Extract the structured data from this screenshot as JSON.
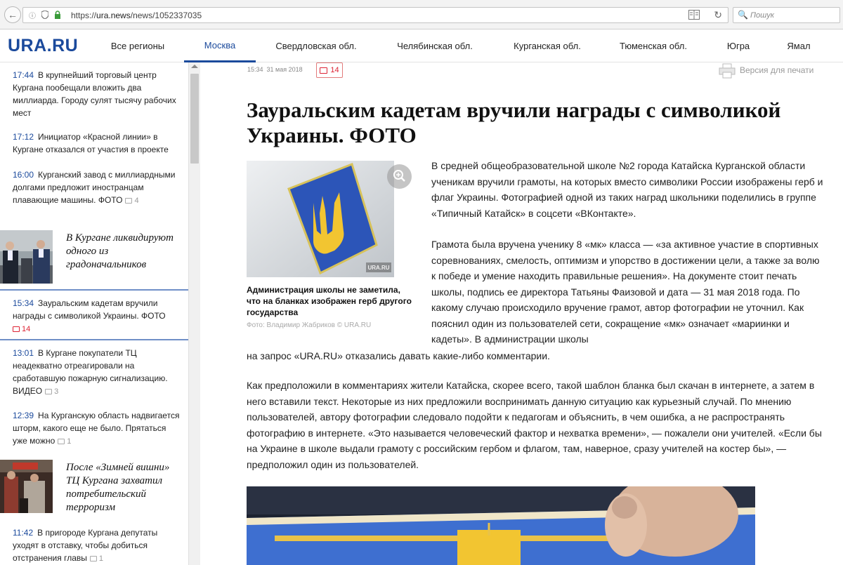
{
  "browser": {
    "url_scheme": "https://",
    "url_host": "ura.news",
    "url_path": "/news/1052337035",
    "search_placeholder": "Пошук"
  },
  "header": {
    "logo": "URA.RU",
    "nav": [
      {
        "label": "Все регионы",
        "active": false
      },
      {
        "label": "Москва",
        "active": true
      },
      {
        "label": "Свердловская обл.",
        "active": false
      },
      {
        "label": "Челябинская обл.",
        "active": false
      },
      {
        "label": "Курганская обл.",
        "active": false
      },
      {
        "label": "Тюменская обл.",
        "active": false
      },
      {
        "label": "Югра",
        "active": false
      },
      {
        "label": "Ямал",
        "active": false
      }
    ]
  },
  "sidebar": {
    "news": [
      {
        "time": "17:44",
        "text": "В крупнейший торговый центр Кургана пообещали вложить два миллиарда. Городу сулят тысячу рабочих мест",
        "comments": ""
      },
      {
        "time": "17:12",
        "text": "Инициатор «Красной линии» в Кургане отказался от участия в проекте",
        "comments": ""
      },
      {
        "time": "16:00",
        "text": "Курганский завод с миллиардными долгами предложит иностранцам плавающие машины. ФОТО",
        "comments": "4"
      },
      {
        "time": "15:34",
        "text": "Зауральским кадетам вручили награды с символикой Украины. ФОТО",
        "comments": "14"
      },
      {
        "time": "13:01",
        "text": "В Кургане покупатели ТЦ неадекватно отреагировали на сработавшую пожарную сигнализацию. ВИДЕО",
        "comments": "3"
      },
      {
        "time": "12:39",
        "text": "На Курганскую область надвигается шторм, какого еще не было. Прятаться уже можно",
        "comments": "1"
      },
      {
        "time": "11:42",
        "text": "В пригороде Кургана депутаты уходят в отставку, чтобы добиться отстранения главы",
        "comments": "1"
      }
    ],
    "featured": [
      {
        "text": "В Кургане ликвидируют одного из градоначальников"
      },
      {
        "text": "После «Зимней вишни» ТЦ Кургана захватил потребительский терроризм"
      }
    ]
  },
  "article": {
    "time": "15:34",
    "date": "31 мая 2018",
    "comments": "14",
    "print_label": "Версия для печати",
    "title": "Зауральским кадетам вручили награды с символикой Украины. ФОТО",
    "photo_watermark": "URA.RU",
    "photo_caption": "Администрация школы не заметила, что на бланках изображен герб другого государства",
    "photo_credit": "Фото: Владимир Жабриков © URA.RU",
    "p1": "В средней общеобразовательной школе №2 города Катайска Курганской области ученикам вручили грамоты, на которых вместо символики России изображены герб и флаг Украины. Фотографией одной из таких наград школьники поделились в группе «Типичный Катайск» в соцсети «ВКонтакте».",
    "p2a": "Грамота была вручена ученику 8 «мк» класса — «за активное участие в спортивных соревнованиях, смелость, оптимизм и упорство в достижении цели, а также за волю к победе и умение находить правильные решения». На документе стоит печать школы, подпись ее директора Татьяны Фаизовой и дата — 31 мая 2018 года. По какому случаю происходило вручение грамот, автор фотографии не уточнил. Как пояснил один из пользователей сети, сокращение «мк» означает «мариинки и кадеты». В администрации школы",
    "p2b": "на запрос «URA.RU» отказались давать какие-либо комментарии.",
    "p3": "Как предположили в комментариях жители Катайска, скорее всего, такой шаблон бланка был скачан в интернете, а затем в него вставили текст. Некоторые из них предложили воспринимать данную ситуацию как курьезный случай. По мнению пользователей, автору фотографии следовало подойти к педагогам и объяснить, в чем ошибка, а не распространять фотографию в интернете. «Это называется человеческий фактор и нехватка времени», — пожалели они учителей. «Если бы на Украине в школе выдали грамоту с российским гербом и флагом, там, наверное, сразу учителей на костер бы», — предположил один из пользователей."
  }
}
